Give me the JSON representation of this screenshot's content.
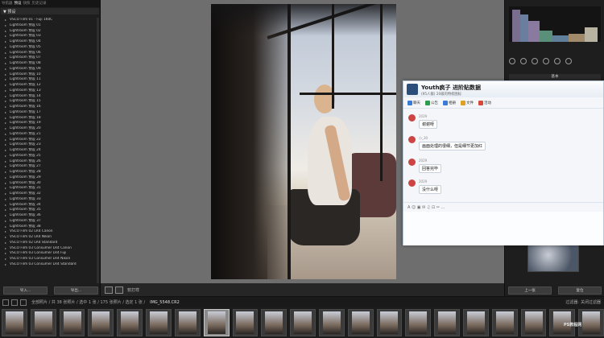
{
  "left_panel": {
    "tabs": [
      "导航器",
      "预设",
      "快照",
      "历史记录"
    ],
    "active_tab": 1,
    "header": "▼ 预设",
    "presets": [
      "VSCO Film 01 - Fuji 160C",
      "Lightroom 预设 01",
      "Lightroom 预设 02",
      "Lightroom 预设 03",
      "Lightroom 预设 04",
      "Lightroom 预设 05",
      "Lightroom 预设 06",
      "Lightroom 预设 07",
      "Lightroom 预设 08",
      "Lightroom 预设 09",
      "Lightroom 预设 10",
      "Lightroom 预设 11",
      "Lightroom 预设 12",
      "Lightroom 预设 13",
      "Lightroom 预设 14",
      "Lightroom 预设 15",
      "Lightroom 预设 16",
      "Lightroom 预设 17",
      "Lightroom 预设 18",
      "Lightroom 预设 19",
      "Lightroom 预设 20",
      "Lightroom 预设 21",
      "Lightroom 预设 22",
      "Lightroom 预设 23",
      "Lightroom 预设 24",
      "Lightroom 预设 25",
      "Lightroom 预设 26",
      "Lightroom 预设 27",
      "Lightroom 预设 28",
      "Lightroom 预设 29",
      "Lightroom 预设 30",
      "Lightroom 预设 31",
      "Lightroom 预设 32",
      "Lightroom 预设 33",
      "Lightroom 预设 34",
      "Lightroom 预设 35",
      "Lightroom 预设 36",
      "Lightroom 预设 37",
      "Lightroom 预设 38",
      "VSCO Film 02 LR4 Canon",
      "VSCO Film 02 LR4 Nikon",
      "VSCO Film 02 LR4 Standard",
      "VSCO Film 03 Consumer LR4 Canon",
      "VSCO Film 03 Consumer LR4 Fuji",
      "VSCO Film 03 Consumer LR4 Nikon",
      "VSCO Film 03 Consumer LR4 Standard"
    ],
    "buttons": [
      "导入...",
      "导出..."
    ]
  },
  "center": {
    "toolbar_text": "软打样"
  },
  "right_panel": {
    "section_label": "基本",
    "buttons": [
      "上一张",
      "复位"
    ]
  },
  "chat": {
    "title": "Youth疯子 进阶贴数据",
    "subtitle": "(95人群) 20级的特权图标",
    "tools": [
      {
        "label": "聊天",
        "color": "#3a7bd5"
      },
      {
        "label": "公告",
        "color": "#2e9b4e"
      },
      {
        "label": "相册",
        "color": "#3a7bd5"
      },
      {
        "label": "文件",
        "color": "#e0a020"
      },
      {
        "label": "活动",
        "color": "#d24a3a"
      }
    ],
    "messages": [
      {
        "name": "2029",
        "text": "谢谢呀"
      },
      {
        "name": "小_30",
        "text": "画面处理的很细，但是细节更加红"
      },
      {
        "name": "2029",
        "text": "回答完毕"
      },
      {
        "name": "2029",
        "text": "没什么呀"
      }
    ],
    "input_tools": "A  ☺  ▣  ✉  ♫  ⊡  ✂  …"
  },
  "status_bar": {
    "left_text": "全部照片 / 共 38 张照片 / 选中 1 张 / 175 张照片 / 选定 1 张 /",
    "filename": "IMG_5548.CR2",
    "filter_label": "过滤器:",
    "right_text": "关闭过滤器"
  },
  "filmstrip": {
    "count": 21,
    "selected_index": 7
  },
  "watermark": "PS教程网"
}
